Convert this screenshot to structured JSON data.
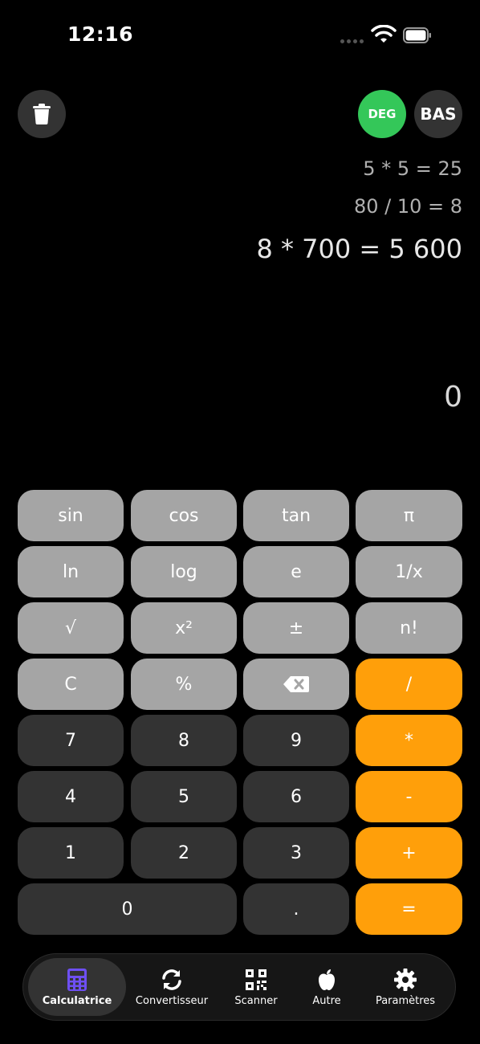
{
  "status_bar": {
    "time": "12:16"
  },
  "top_buttons": {
    "angle_mode": "DEG",
    "base_mode": "BAS",
    "deg_color": "#34c759"
  },
  "history": [
    "5 * 5 = 25",
    "80 / 10 = 8",
    "8 * 700 = 5 600"
  ],
  "display": {
    "value": "0"
  },
  "keypad": {
    "row1": [
      "sin",
      "cos",
      "tan",
      "π"
    ],
    "row2": [
      "ln",
      "log",
      "e",
      "1/x"
    ],
    "row3": [
      "√",
      "x²",
      "±",
      "n!"
    ],
    "row4": [
      "C",
      "%",
      "backspace-icon",
      "/"
    ],
    "row5": [
      "7",
      "8",
      "9",
      "*"
    ],
    "row6": [
      "4",
      "5",
      "6",
      "-"
    ],
    "row7": [
      "1",
      "2",
      "3",
      "+"
    ],
    "row8": [
      "0",
      ".",
      "="
    ],
    "colors": {
      "function": "#a5a5a5",
      "number": "#333333",
      "operator": "#ff9f0a"
    }
  },
  "tabbar": {
    "items": [
      {
        "label": "Calculatrice",
        "icon": "calculator-icon",
        "active": true
      },
      {
        "label": "Convertisseur",
        "icon": "refresh-icon",
        "active": false
      },
      {
        "label": "Scanner",
        "icon": "qr-code-icon",
        "active": false
      },
      {
        "label": "Autre",
        "icon": "apple-icon",
        "active": false
      },
      {
        "label": "Paramètres",
        "icon": "gear-icon",
        "active": false
      }
    ],
    "accent": "#6e4ff2"
  }
}
